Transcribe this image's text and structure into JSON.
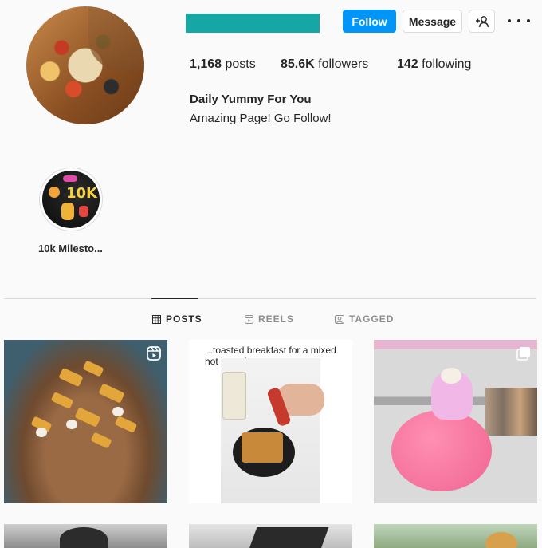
{
  "profile": {
    "stats": {
      "posts_count": "1,168",
      "posts_label": "posts",
      "followers_count": "85.6K",
      "followers_label": "followers",
      "following_count": "142",
      "following_label": "following"
    },
    "bio_name": "Daily Yummy For You",
    "bio_text": "Amazing Page! Go Follow!"
  },
  "actions": {
    "follow_label": "Follow",
    "message_label": "Message",
    "suggest_icon": "add-person-icon",
    "more_icon": "more-icon"
  },
  "highlights": [
    {
      "label": "10k Milesto...",
      "cover_text": "10K"
    }
  ],
  "tabs": [
    {
      "label": "POSTS",
      "icon": "grid-icon",
      "active": true
    },
    {
      "label": "REELS",
      "icon": "reels-icon",
      "active": false
    },
    {
      "label": "TAGGED",
      "icon": "tagged-icon",
      "active": false
    }
  ],
  "posts": [
    {
      "type": "reel",
      "badge_icon": "reels-icon"
    },
    {
      "type": "image",
      "caption": "...toasted breakfast for a mixed hot brunch"
    },
    {
      "type": "carousel",
      "badge_icon": "carousel-icon"
    }
  ],
  "colors": {
    "follow_button": "#0095f6",
    "username_bar": "#16a6a4"
  }
}
